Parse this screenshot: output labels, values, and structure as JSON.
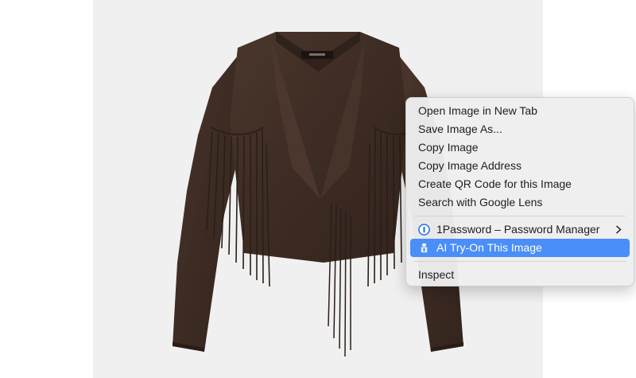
{
  "context_menu": {
    "items": [
      {
        "label": "Open Image in New Tab"
      },
      {
        "label": "Save Image As..."
      },
      {
        "label": "Copy Image"
      },
      {
        "label": "Copy Image Address"
      },
      {
        "label": "Create QR Code for this Image"
      },
      {
        "label": "Search with Google Lens"
      }
    ],
    "extensions": [
      {
        "label": "1Password – Password Manager",
        "icon": "1password-icon",
        "has_submenu": true
      },
      {
        "label": "AI Try-On This Image",
        "icon": "ai-tryon-icon",
        "highlighted": true
      }
    ],
    "inspect": {
      "label": "Inspect"
    }
  },
  "colors": {
    "highlight": "#4a8ef7",
    "image_background": "#f1f0f0",
    "jacket": "#3d2c24"
  }
}
